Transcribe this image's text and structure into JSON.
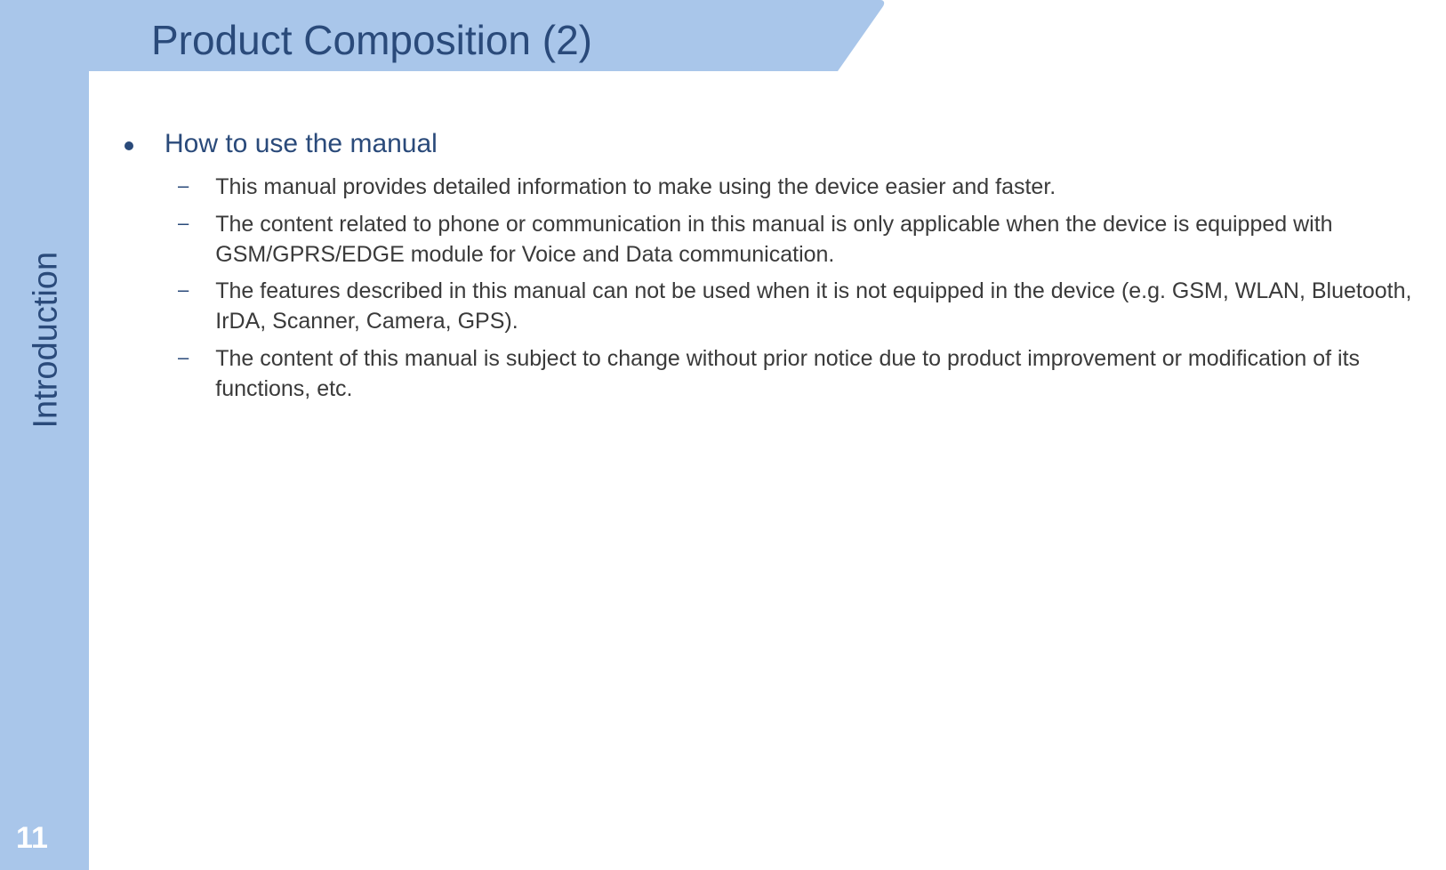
{
  "slide": {
    "title": "Product Composition (2)",
    "section_label": "Introduction",
    "page_number": "11"
  },
  "content": {
    "main_bullet": "How to use the manual",
    "sub_bullets": [
      "This manual provides detailed information to make using the device easier and faster.",
      "The content related to phone or communication in this manual is only applicable when the device is equipped with GSM/GPRS/EDGE module for Voice and Data communication.",
      "The features described in this manual can not be used when it is not equipped in the device (e.g. GSM, WLAN, Bluetooth, IrDA, Scanner, Camera, GPS).",
      "The content of this manual is subject to change without prior notice due to product improvement or modification of its functions, etc."
    ]
  }
}
